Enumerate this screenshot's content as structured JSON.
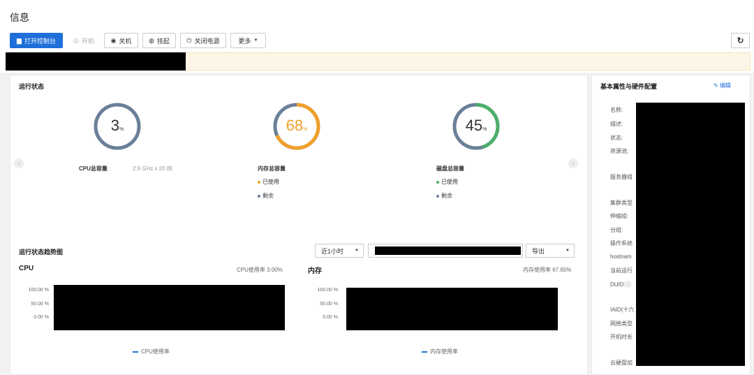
{
  "page": {
    "title": "信息"
  },
  "toolbar": {
    "open_console": "打开控制台",
    "power_on": "开机",
    "power_off": "关机",
    "suspend": "挂起",
    "power_cut": "关闭电源",
    "more": "更多"
  },
  "status": {
    "title": "运行状态",
    "cpu": {
      "value": "3",
      "unit": "%",
      "percent": 3,
      "label": "CPU总容量",
      "detail": "2.9 GHz x 20 核",
      "color": "#6b7f99"
    },
    "memory": {
      "value": "68",
      "unit": "%",
      "percent": 68,
      "label": "内存总容量",
      "used": "已使用",
      "remain": "剩余",
      "color": "#f0a02a"
    },
    "disk": {
      "value": "45",
      "unit": "%",
      "percent": 45,
      "label": "磁盘总容量",
      "used": "已使用",
      "remain": "剩余",
      "color": "#4cae6a"
    }
  },
  "trend": {
    "title": "运行状态趋势图",
    "range": "近1小时",
    "export": "导出",
    "cpu": {
      "title": "CPU",
      "usage": "CPU使用率 3.00%",
      "ticks": [
        "100.00 %",
        "50.00 %",
        "0.00 %"
      ],
      "legend": "CPU使用率"
    },
    "memory": {
      "title": "内存",
      "usage": "内存使用率 67.65%",
      "ticks": [
        "100.00 %",
        "50.00 %",
        "0.00 %"
      ],
      "legend": "内存使用率"
    }
  },
  "props": {
    "title": "基本属性与硬件配置",
    "edit": "编辑",
    "items": [
      "名称:",
      "描述:",
      "状态:",
      "资源池:",
      "服务器组",
      "集群类型",
      "伸缩组:",
      "分组:",
      "操作系统",
      "hostnam",
      "当前运行",
      "DUID:ⓘ",
      "IAID(十六",
      "网络类型",
      "开机时长",
      "云硬盘加"
    ]
  },
  "colors": {
    "primary": "#1e6fd9",
    "track": "#6b7f99"
  }
}
